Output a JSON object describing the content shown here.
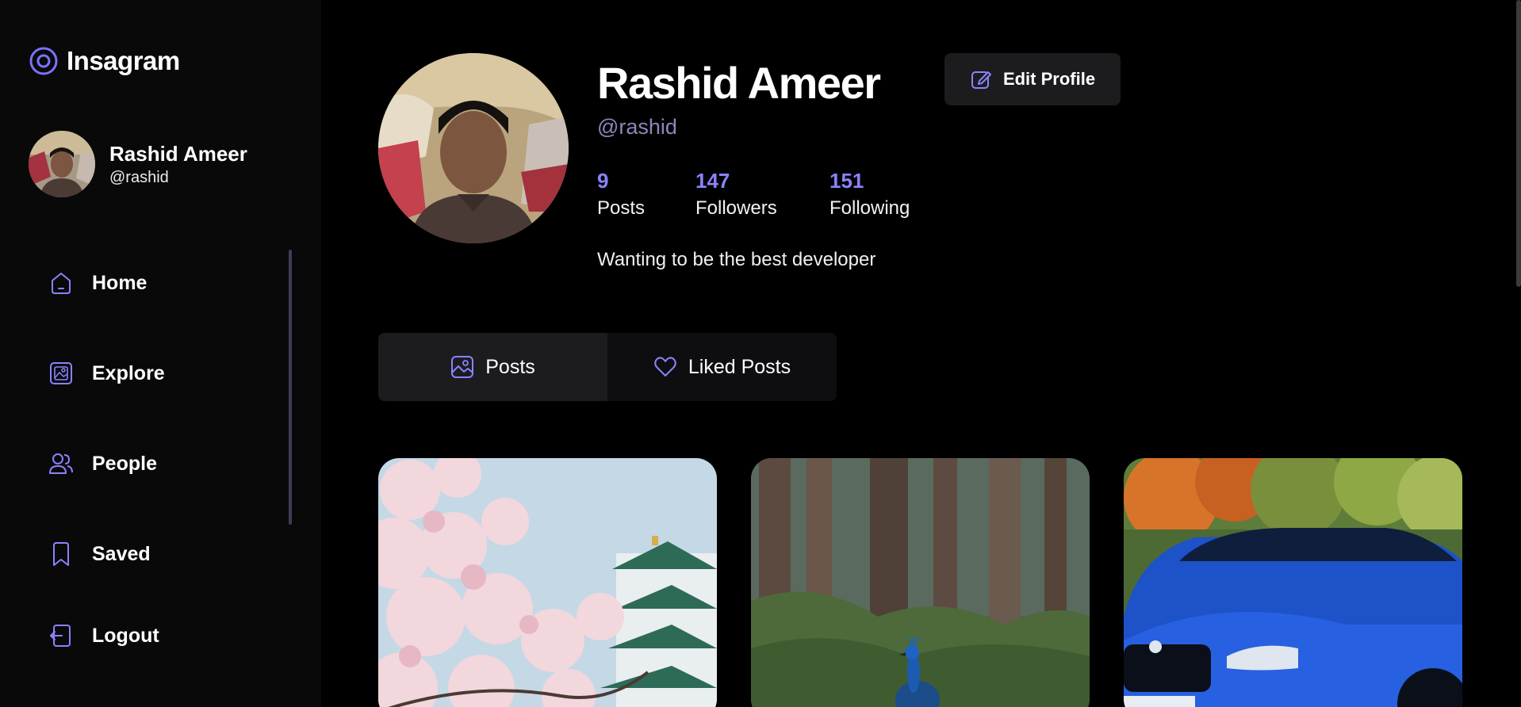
{
  "app": {
    "name": "Insagram",
    "accent": "#8a83ff"
  },
  "sidebar": {
    "user": {
      "name": "Rashid Ameer",
      "handle": "@rashid"
    },
    "items": [
      {
        "label": "Home",
        "icon": "home-icon"
      },
      {
        "label": "Explore",
        "icon": "explore-icon"
      },
      {
        "label": "People",
        "icon": "people-icon"
      },
      {
        "label": "Saved",
        "icon": "saved-icon"
      },
      {
        "label": "Logout",
        "icon": "logout-icon"
      }
    ]
  },
  "profile": {
    "name": "Rashid Ameer",
    "handle": "@rashid",
    "edit_label": "Edit Profile",
    "stats": [
      {
        "value": "9",
        "label": "Posts"
      },
      {
        "value": "147",
        "label": "Followers"
      },
      {
        "value": "151",
        "label": "Following"
      }
    ],
    "bio": "Wanting to be the best developer"
  },
  "tabs": [
    {
      "label": "Posts",
      "icon": "image-icon",
      "active": true
    },
    {
      "label": "Liked Posts",
      "icon": "heart-icon",
      "active": false
    }
  ],
  "posts": [
    {
      "subject": "cherry blossoms and castle"
    },
    {
      "subject": "peacock in forest"
    },
    {
      "subject": "blue car"
    }
  ]
}
